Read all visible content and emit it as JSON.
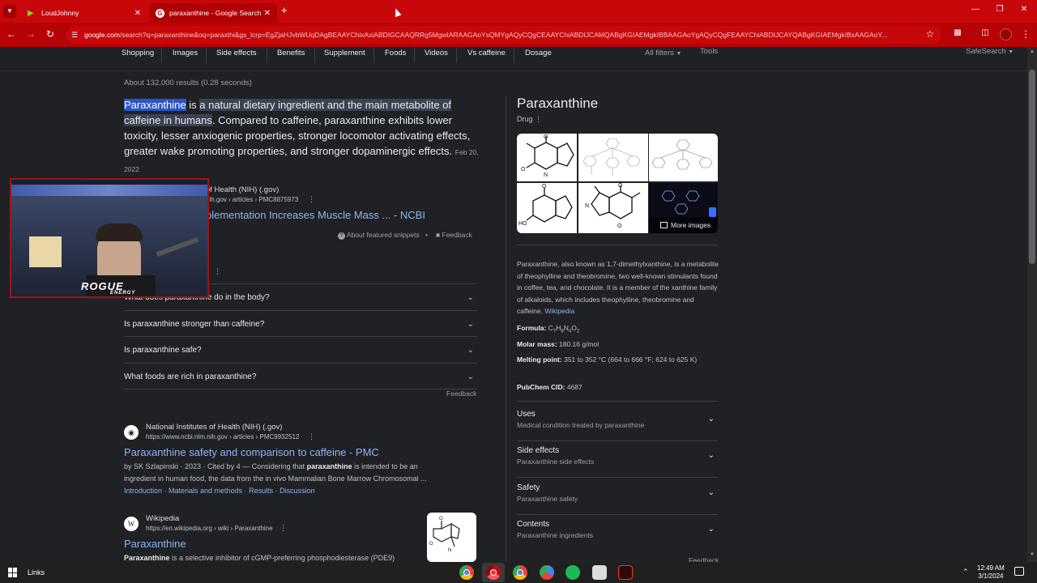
{
  "browser": {
    "tabs": [
      {
        "label": "LoudJohnny"
      },
      {
        "label": "paraxanthine - Google Search"
      }
    ],
    "url_host": "google.com",
    "url_rest": "/search?q=paraxanthine&oq=paraxthi&gs_lcrp=EgZjaHJvbWUqDAgBEAAYChixAxiABDIGCAAQRRg5MgwIARAAGAoYsQMYgAQyCQgCEAAYChiABDIJCAMQABgKGIAEMgkIBBAAGAoYgAQyCQgFEAAYChiABDIJCAYQABgKGIAEMgkIBxAAGAoY..."
  },
  "filters": {
    "chips": [
      "Shopping",
      "Images",
      "Side effects",
      "Benefits",
      "Supplement",
      "Foods",
      "Videos",
      "Vs caffeine",
      "Dosage"
    ],
    "all_filters": "All filters",
    "tools": "Tools",
    "safesearch": "SafeSearch"
  },
  "results": {
    "stats": "About 132,000 results (0.28 seconds)",
    "featured": {
      "term": "Paraxanthine",
      "is": " is ",
      "highlight": "a natural dietary ingredient and the main metabolite of caffeine in humans",
      "rest": ". Compared to caffeine, paraxanthine exhibits lower toxicity, lesser anxiogenic properties, stronger locomotor activating effects, greater wake promoting properties, and stronger dopaminergic effects.",
      "date": "Feb 20, 2022",
      "source_name": "National Institutes of Health (NIH) (.gov)",
      "source_name_visible": "of Health (NIH) (.gov)",
      "source_url_visible": "nih.gov › articles › PMC8875973",
      "link_visible": "plementation Increases Muscle Mass ... - NCBI",
      "about": "About featured snippets",
      "feedback": "Feedback"
    },
    "paa": [
      "What does paraxanthine do in the body?",
      "Is paraxanthine stronger than caffeine?",
      "Is paraxanthine safe?",
      "What foods are rich in paraxanthine?"
    ],
    "paa_feedback": "Feedback",
    "r1": {
      "source": "National Institutes of Health (NIH) (.gov)",
      "url": "https://www.ncbi.nlm.nih.gov › articles › PMC9932512",
      "title": "Paraxanthine safety and comparison to caffeine - PMC",
      "meta": "by SK Szlapinski · 2023 · Cited by 4 — Considering that ",
      "meta_bold": "paraxanthine",
      "meta_rest": " is intended to be an",
      "line2": "ingredient in human food, the data from the in vivo Mammalian Bone Marrow Chromosomal ...",
      "sitelinks": [
        "Introduction",
        "Materials and methods",
        "Results",
        "Discussion"
      ]
    },
    "r2": {
      "source": "Wikipedia",
      "url": "https://en.wikipedia.org › wiki › Paraxanthine",
      "title": "Paraxanthine",
      "bold": "Paraxanthine",
      "rest": " is a selective inhibitor of cGMP-preferring phosphodiesterase (PDE9)"
    }
  },
  "panel": {
    "title": "Paraxanthine",
    "subtitle": "Drug",
    "more_images": "More images",
    "description": "Paraxanthine, also known as 1,7-dimethylxanthine, is a metabolite of theophylline and theobromine, two well-known stimulants found in coffee, tea, and chocolate. It is a member of the xanthine family of alkaloids, which includes theophylline, theobromine and caffeine.",
    "wikipedia": "Wikipedia",
    "formula_label": "Formula:",
    "formula": {
      "c": "C",
      "c_n": "7",
      "h": "H",
      "h_n": "8",
      "n": "N",
      "n_n": "4",
      "o": "O",
      "o_n": "2"
    },
    "molar_label": "Molar mass:",
    "molar": "180.16 g/mol",
    "melting_label": "Melting point:",
    "melting": "351 to 352 °C (664 to 666 °F; 624 to 625 K)",
    "pubchem_label": "PubChem CID:",
    "pubchem": "4687",
    "accordions": [
      {
        "title": "Uses",
        "sub": "Medical condition treated by paraxanthine"
      },
      {
        "title": "Side effects",
        "sub": "Paraxanthine side effects"
      },
      {
        "title": "Safety",
        "sub": "Paraxanthine safety"
      },
      {
        "title": "Contents",
        "sub": "Paraxanthine ingredients"
      }
    ],
    "feedback": "Feedback"
  },
  "webcam": {
    "brand": "ROGUE",
    "brand_sub": "ENERGY"
  },
  "taskbar": {
    "links": "Links",
    "time": "12:49 AM",
    "date": "3/1/2024"
  },
  "colors": {
    "titlebar": "#c8070b",
    "link": "#8ab4f8",
    "background": "#202124"
  }
}
